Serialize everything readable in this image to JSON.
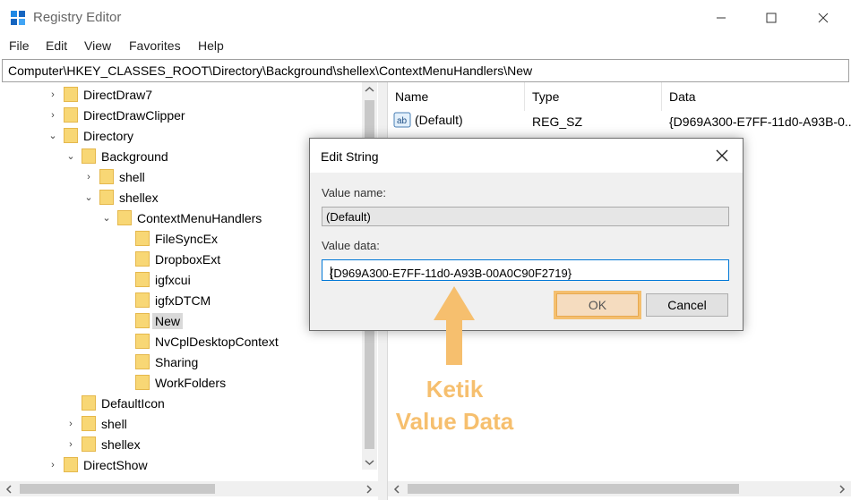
{
  "window": {
    "title": "Registry Editor"
  },
  "menu": [
    "File",
    "Edit",
    "View",
    "Favorites",
    "Help"
  ],
  "address": "Computer\\HKEY_CLASSES_ROOT\\Directory\\Background\\shellex\\ContextMenuHandlers\\New",
  "tree": [
    {
      "label": "DirectDraw7",
      "toggle": "›",
      "indent": 0
    },
    {
      "label": "DirectDrawClipper",
      "toggle": "›",
      "indent": 0
    },
    {
      "label": "Directory",
      "toggle": "⌄",
      "indent": 0
    },
    {
      "label": "Background",
      "toggle": "⌄",
      "indent": 1
    },
    {
      "label": "shell",
      "toggle": "›",
      "indent": 2
    },
    {
      "label": "shellex",
      "toggle": "⌄",
      "indent": 2
    },
    {
      "label": "ContextMenuHandlers",
      "toggle": "⌄",
      "indent": 3
    },
    {
      "label": "FileSyncEx",
      "toggle": "",
      "indent": 4
    },
    {
      "label": "DropboxExt",
      "toggle": "",
      "indent": 4
    },
    {
      "label": "igfxcui",
      "toggle": "",
      "indent": 4
    },
    {
      "label": "igfxDTCM",
      "toggle": "",
      "indent": 4
    },
    {
      "label": "New",
      "toggle": "",
      "indent": 4,
      "selected": true
    },
    {
      "label": "NvCplDesktopContext",
      "toggle": "",
      "indent": 4
    },
    {
      "label": "Sharing",
      "toggle": "",
      "indent": 4
    },
    {
      "label": "WorkFolders",
      "toggle": "",
      "indent": 4
    },
    {
      "label": "DefaultIcon",
      "toggle": "",
      "indent": 1
    },
    {
      "label": "shell",
      "toggle": "›",
      "indent": 1
    },
    {
      "label": "shellex",
      "toggle": "›",
      "indent": 1
    },
    {
      "label": "DirectShow",
      "toggle": "›",
      "indent": 0
    }
  ],
  "list": {
    "columns": [
      "Name",
      "Type",
      "Data"
    ],
    "rows": [
      {
        "name": "(Default)",
        "type": "REG_SZ",
        "data": "{D969A300-E7FF-11d0-A93B-0..."
      }
    ]
  },
  "dialog": {
    "title": "Edit String",
    "value_name_label": "Value name:",
    "value_name": "(Default)",
    "value_data_label": "Value data:",
    "value_data": "{D969A300-E7FF-11d0-A93B-00A0C90F2719}",
    "ok_label": "OK",
    "cancel_label": "Cancel"
  },
  "annotation": {
    "line1": "Ketik",
    "line2": "Value Data",
    "color": "#f6bf6e"
  }
}
